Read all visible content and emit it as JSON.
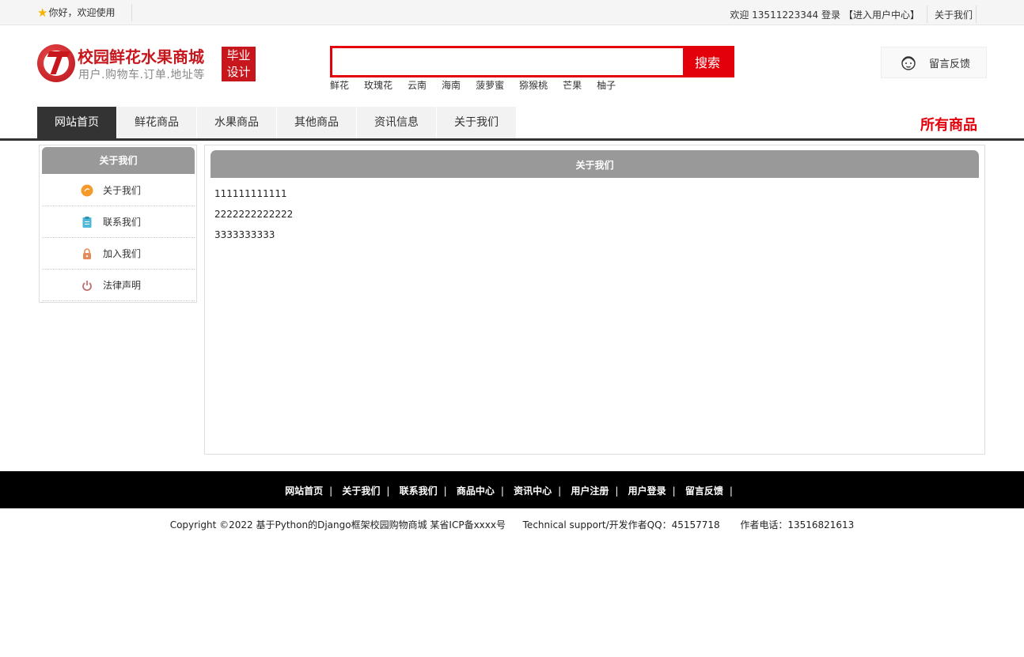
{
  "topbar": {
    "greeting": "你好，欢迎使用",
    "welcome": "欢迎 13511223344 登录",
    "user_center": "【进入用户中心】",
    "about": "关于我们"
  },
  "logo": {
    "name": "校园鲜花水果商城",
    "subtitle": "用户.购物车.订单.地址等",
    "badge_line1": "毕业",
    "badge_line2": "设计"
  },
  "search": {
    "value": "",
    "button": "搜索",
    "hotwords": [
      "鲜花",
      "玫瑰花",
      "云南",
      "海南",
      "菠萝蜜",
      "猕猴桃",
      "芒果",
      "柚子"
    ]
  },
  "feedback": {
    "label": "留言反馈"
  },
  "nav": {
    "items": [
      "网站首页",
      "鲜花商品",
      "水果商品",
      "其他商品",
      "资讯信息",
      "关于我们"
    ],
    "all_products": "所有商品"
  },
  "sidebar": {
    "title": "关于我们",
    "items": [
      {
        "label": "关于我们",
        "icon": "orange-circle-icon",
        "color": "#f39a2b"
      },
      {
        "label": "联系我们",
        "icon": "clipboard-icon",
        "color": "#4fb8d8"
      },
      {
        "label": "加入我们",
        "icon": "lock-icon",
        "color": "#e58a5a"
      },
      {
        "label": "法律声明",
        "icon": "power-icon",
        "color": "#c07070"
      }
    ]
  },
  "main": {
    "title": "关于我们",
    "lines": [
      "111111111111",
      "2222222222222",
      "3333333333"
    ]
  },
  "footer": {
    "links": [
      "网站首页",
      "关于我们",
      "联系我们",
      "商品中心",
      "资讯中心",
      "用户注册",
      "用户登录",
      "留言反馈"
    ],
    "copyright": "Copyright ©2022 基于Python的Django框架校园购物商城 某省ICP备xxxx号",
    "support": "Technical support/开发作者QQ：45157718",
    "phone": "作者电话：13516821613"
  }
}
